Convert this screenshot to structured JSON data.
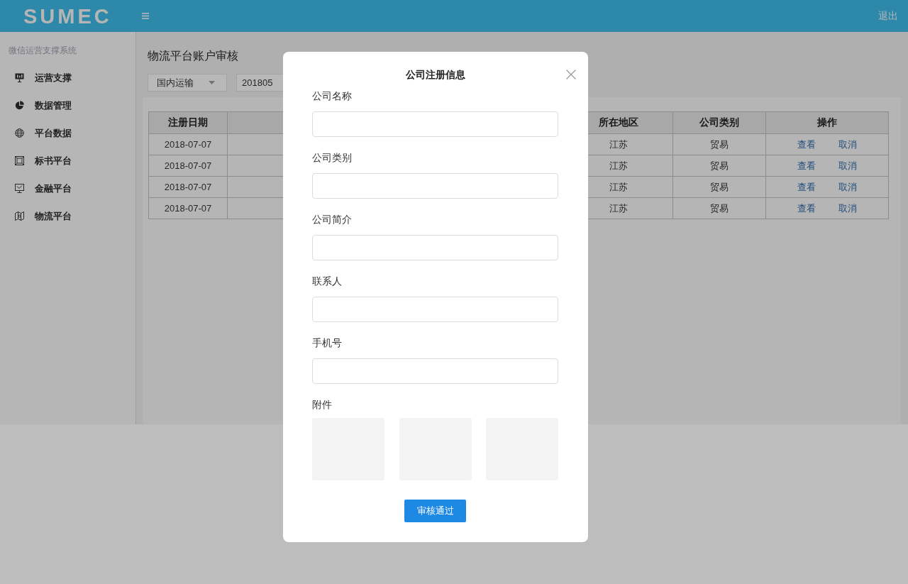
{
  "header": {
    "logo": "SUMEC",
    "logout": "退出"
  },
  "sidebar": {
    "title": "微信运营支撑系统",
    "items": [
      {
        "label": "运营支撑"
      },
      {
        "label": "数据管理"
      },
      {
        "label": "平台数据"
      },
      {
        "label": "标书平台"
      },
      {
        "label": "金融平台"
      },
      {
        "label": "物流平台"
      }
    ]
  },
  "page": {
    "title": "物流平台账户审核",
    "category_select": {
      "value": "国内运输"
    },
    "period_field": {
      "value": "201805"
    }
  },
  "table": {
    "columns": [
      {
        "label": "注册日期"
      },
      {
        "label": "所在地区"
      },
      {
        "label": "公司类别"
      },
      {
        "label": "操作"
      }
    ],
    "rows": [
      {
        "cells": [
          "2018-07-07",
          "江苏",
          "贸易"
        ],
        "actions": [
          "查看",
          "取消"
        ]
      },
      {
        "cells": [
          "2018-07-07",
          "江苏",
          "贸易"
        ],
        "actions": [
          "查看",
          "取消"
        ]
      },
      {
        "cells": [
          "2018-07-07",
          "江苏",
          "贸易"
        ],
        "actions": [
          "查看",
          "取消"
        ]
      },
      {
        "cells": [
          "2018-07-07",
          "江苏",
          "贸易"
        ],
        "actions": [
          "查看",
          "取消"
        ]
      }
    ]
  },
  "modal": {
    "title": "公司注册信息",
    "fields": [
      {
        "label": "公司名称"
      },
      {
        "label": "公司类别"
      },
      {
        "label": "公司简介"
      },
      {
        "label": "联系人"
      },
      {
        "label": "手机号"
      }
    ],
    "attachments": {
      "label": "附件",
      "slots": [
        {
          "filled": false
        },
        {
          "filled": false
        },
        {
          "filled": false
        }
      ]
    },
    "submit": "审核通过"
  }
}
